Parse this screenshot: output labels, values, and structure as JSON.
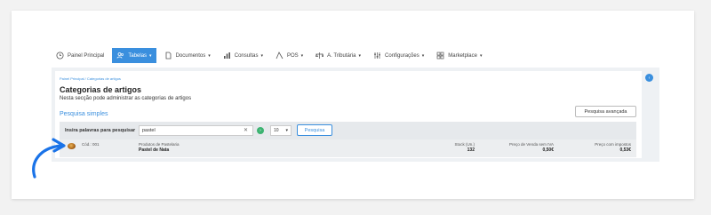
{
  "nav": {
    "items": [
      {
        "label": "Painel Principal",
        "icon": "clock-icon"
      },
      {
        "label": "Tabelas",
        "icon": "users-icon",
        "active": true
      },
      {
        "label": "Documentos",
        "icon": "document-icon"
      },
      {
        "label": "Consultas",
        "icon": "bar-chart-icon"
      },
      {
        "label": "POS",
        "icon": "pos-icon"
      },
      {
        "label": "A. Tributária",
        "icon": "balance-icon"
      },
      {
        "label": "Configurações",
        "icon": "sliders-icon"
      },
      {
        "label": "Marketplace",
        "icon": "store-icon"
      }
    ]
  },
  "page": {
    "breadcrumb": "Painel Principal / Categorias de artigos",
    "title": "Categorias de artigos",
    "subtitle": "Nesta secção pode administrar as categorias de artigos",
    "advanced_search": "Pesquisa avançada",
    "simple_search": "Pesquisa simples"
  },
  "search": {
    "label": "Insira palavras para pesquisar",
    "value": "pastel",
    "count": "10",
    "button": "Pesquisa"
  },
  "result": {
    "code": "Cód.: 001",
    "category": "Produtos de Pastelaria",
    "name": "Pastel de Nata",
    "stock_label": "Stock (Un.)",
    "stock_value": "132",
    "price_label": "Preço de Venda sem IVA",
    "price_value": "0,50€",
    "price_tax_label": "Preço com impostos",
    "price_tax_value": "0,53€"
  },
  "colors": {
    "accent": "#3a8fde",
    "go": "#3cb371"
  }
}
